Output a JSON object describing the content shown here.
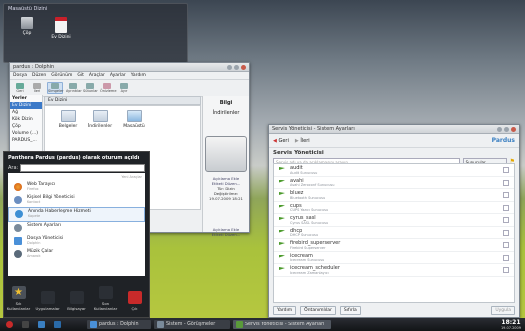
{
  "desktop": {
    "folder_title": "Masaüstü Dizini",
    "icons": [
      {
        "label": "Çöp"
      },
      {
        "label": "Ev Dizini"
      }
    ]
  },
  "dolphin": {
    "title": "pardus : Dolphin",
    "menu": [
      "Dosya",
      "Düzen",
      "Görünüm",
      "Git",
      "Araçlar",
      "Ayarlar",
      "Yardım"
    ],
    "toolbar": [
      "Geri",
      "İleri",
      "Simgeler",
      "Ayrıntılar",
      "Sütunlar",
      "Önizleme",
      "Ayır"
    ],
    "places_header": "Yerler",
    "places": [
      "Ev Dizini",
      "Ağ",
      "Kök Dizin",
      "Çöp",
      "Volume (...)",
      "PARDUS_..."
    ],
    "breadcrumb": "Ev Dizini",
    "files": [
      {
        "label": "Belgeler"
      },
      {
        "label": "İndirilenler"
      },
      {
        "label": "Masaüstü"
      }
    ],
    "info": {
      "header": "Bilgi",
      "folder_name": "İndirilenler",
      "link": "Açıklama Ekle",
      "tag": "Etiketi Düzen...",
      "type": "Tür: Dizin",
      "date": "Değiştirilme: 19.07.2009 18:21",
      "link2": "Açıklama Ekle",
      "link3": "Etiketi Düzen..."
    },
    "free_space": "9,2GB Boş"
  },
  "launcher": {
    "user_line": "Panthera Pardus (pardus) olarak oturum açıldı",
    "search_label": "Ara:",
    "sub": "Yeni Araçlar",
    "items": [
      {
        "name": "Web Tarayıcı",
        "desc": "Firefox"
      },
      {
        "name": "Kişisel Bilgi Yöneticisi",
        "desc": "Kontact"
      },
      {
        "name": "Anında Haberleşme Hizmeti",
        "desc": "Kopete"
      },
      {
        "name": "Sistem Ayarları",
        "desc": ""
      },
      {
        "name": "Dosya Yöneticisi",
        "desc": "Dolphin"
      },
      {
        "name": "Müzik Çalar",
        "desc": "Amarok"
      }
    ],
    "tabs": [
      "Sık Kullanılanlar",
      "Uygulamalar",
      "Bilgisayar",
      "Son Kullanılanlar",
      "Çık"
    ]
  },
  "service_manager": {
    "title": "Servis Yöneticisi - Sistem Ayarları",
    "toolbar": {
      "back": "Geri",
      "forward": "İleri"
    },
    "brand": "Pardus",
    "header": "Servis Yöneticisi",
    "search_placeholder": "Servis adı ya da açıklamasını arayın",
    "filter": "Sunucular",
    "services": [
      {
        "name": "audit",
        "desc": "Audit Sunucusu"
      },
      {
        "name": "avahi",
        "desc": "Avahi Zeroconf Sunucusu"
      },
      {
        "name": "bluez",
        "desc": "Bluetooth Sunucusu"
      },
      {
        "name": "cups",
        "desc": "CUPS Yazıcı Sunucusu"
      },
      {
        "name": "cyrus_sasl",
        "desc": "Cyrus SASL Sunucusu"
      },
      {
        "name": "dhcp",
        "desc": "DHCP Sunucusu"
      },
      {
        "name": "firebird_superserver",
        "desc": "Firebird Superserver"
      },
      {
        "name": "icecream",
        "desc": "Icecream Sunucusu"
      },
      {
        "name": "icecream_scheduler",
        "desc": "Icecream Zamanlayıcı"
      }
    ],
    "bottom": {
      "help": "Yardım",
      "defaults": "Öntanımlılar",
      "reset": "Sıfırla",
      "apply": "Uygula"
    }
  },
  "taskbar": {
    "tasks": [
      {
        "label": "pardus : Dolphin"
      },
      {
        "label": "Sistem - Görüşmeler"
      },
      {
        "label": "Servis Yöneticisi - Sistem Ayarları"
      }
    ],
    "time": "18:21",
    "date": "19.07.2009"
  }
}
